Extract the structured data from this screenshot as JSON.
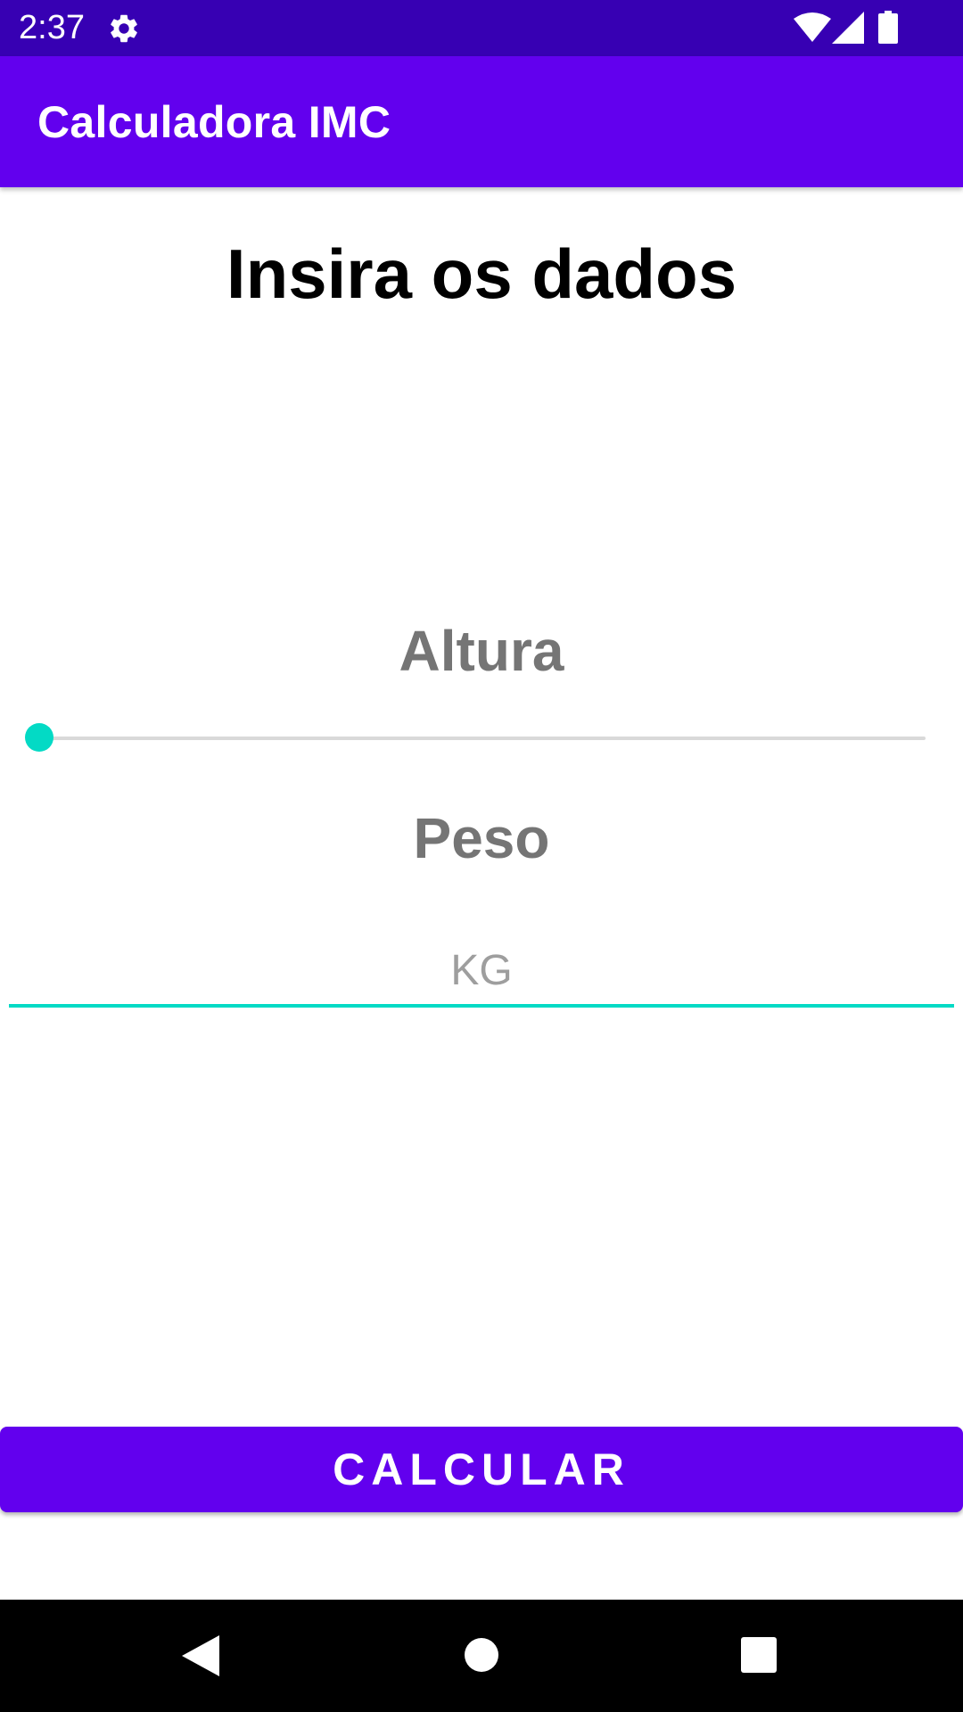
{
  "status_bar": {
    "time": "2:37",
    "icons": [
      "gear-icon",
      "wifi-icon",
      "signal-icon",
      "battery-icon"
    ]
  },
  "app_bar": {
    "title": "Calculadora IMC"
  },
  "main": {
    "heading": "Insira os dados",
    "altura_label": "Altura",
    "altura_slider_value": 0,
    "peso_label": "Peso",
    "peso_value": "",
    "peso_placeholder": "KG",
    "calculate_label": "CALCULAR"
  },
  "nav_bar": {
    "icons": [
      "back-icon",
      "home-icon",
      "recents-icon"
    ]
  },
  "colors": {
    "status_bar": "#3700b3",
    "primary": "#6200ee",
    "accent": "#03dac5",
    "label_gray": "#757575"
  }
}
